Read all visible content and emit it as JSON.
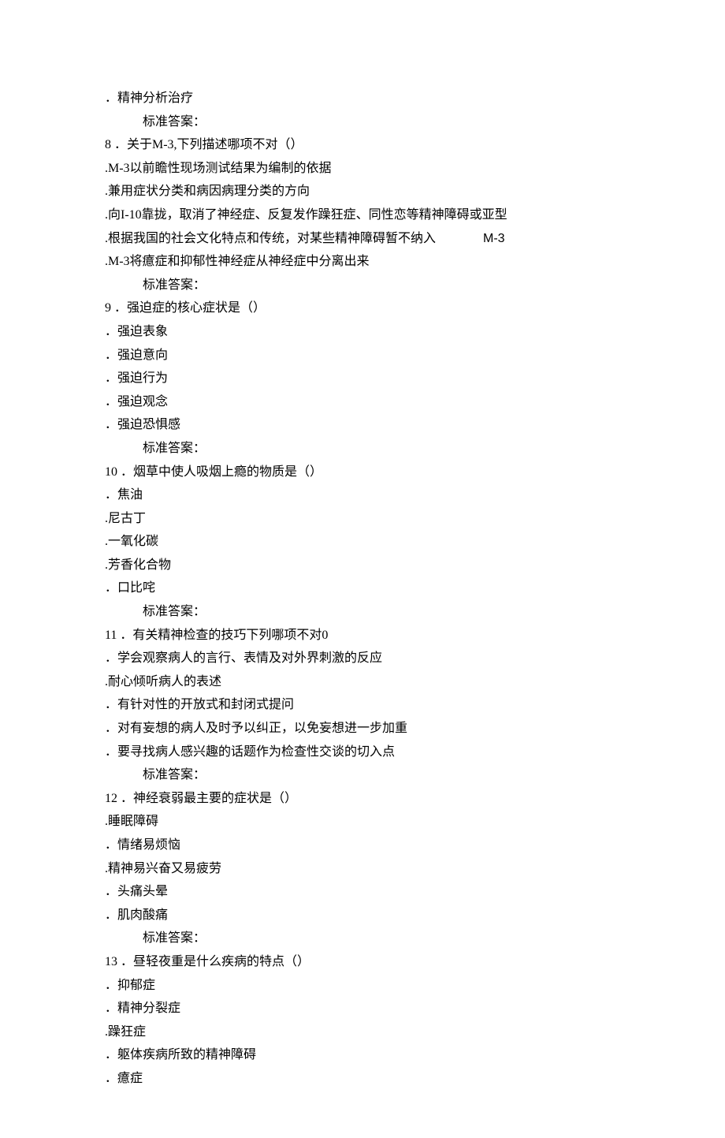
{
  "lines": [
    {
      "text": "．精神分析治疗",
      "indent": 0
    },
    {
      "text": "标准答案：",
      "indent": 1
    },
    {
      "text": "8 ．关于M-3,下列描述哪项不对（）",
      "indent": 0
    },
    {
      "text": ".M-3以前瞻性现场测试结果为编制的依据",
      "indent": 0
    },
    {
      "text": ".兼用症状分类和病因病理分类的方向",
      "indent": 0
    },
    {
      "text": ".向I-10靠拢，取消了神经症、反复发作躁狂症、同性恋等精神障碍或亚型",
      "indent": 0
    },
    {
      "text": ".根据我国的社会文化特点和传统，对某些精神障碍暂不纳入",
      "indent": 0,
      "right": "M-3"
    },
    {
      "text": ".M-3将癔症和抑郁性神经症从神经症中分离出来",
      "indent": 0
    },
    {
      "text": "标准答案：",
      "indent": 1
    },
    {
      "text": "9 ．强迫症的核心症状是（）",
      "indent": 0
    },
    {
      "text": "．强迫表象",
      "indent": 0
    },
    {
      "text": "．强迫意向",
      "indent": 0
    },
    {
      "text": "．强迫行为",
      "indent": 0
    },
    {
      "text": "．强迫观念",
      "indent": 0
    },
    {
      "text": "．强迫恐惧感",
      "indent": 0
    },
    {
      "text": "标准答案：",
      "indent": 1
    },
    {
      "text": "10 ．烟草中使人吸烟上瘾的物质是（）",
      "indent": 0
    },
    {
      "text": "．焦油",
      "indent": 0
    },
    {
      "text": ".尼古丁",
      "indent": 0
    },
    {
      "text": ".一氧化碳",
      "indent": 0
    },
    {
      "text": ".芳香化合物",
      "indent": 0
    },
    {
      "text": "．口比咤",
      "indent": 0
    },
    {
      "text": "标准答案：",
      "indent": 1
    },
    {
      "text": "11 ．有关精神检查的技巧下列哪项不对0",
      "indent": 0
    },
    {
      "text": "．学会观察病人的言行、表情及对外界刺激的反应",
      "indent": 0
    },
    {
      "text": ".耐心倾听病人的表述",
      "indent": 0
    },
    {
      "text": "．有针对性的开放式和封闭式提问",
      "indent": 0
    },
    {
      "text": "．对有妄想的病人及时予以纠正，以免妄想进一步加重",
      "indent": 0
    },
    {
      "text": "．要寻找病人感兴趣的话题作为检查性交谈的切入点",
      "indent": 0
    },
    {
      "text": "标准答案：",
      "indent": 1
    },
    {
      "text": "12 ．神经衰弱最主要的症状是（）",
      "indent": 0
    },
    {
      "text": ".睡眠障碍",
      "indent": 0
    },
    {
      "text": "．情绪易烦恼",
      "indent": 0
    },
    {
      "text": ".精神易兴奋又易疲劳",
      "indent": 0
    },
    {
      "text": "．头痛头晕",
      "indent": 0
    },
    {
      "text": "．肌肉酸痛",
      "indent": 0
    },
    {
      "text": "标准答案：",
      "indent": 1
    },
    {
      "text": "13 ．昼轻夜重是什么疾病的特点（）",
      "indent": 0
    },
    {
      "text": "．抑郁症",
      "indent": 0
    },
    {
      "text": "．精神分裂症",
      "indent": 0
    },
    {
      "text": ".躁狂症",
      "indent": 0
    },
    {
      "text": "．躯体疾病所致的精神障碍",
      "indent": 0
    },
    {
      "text": "．癔症",
      "indent": 0
    }
  ]
}
